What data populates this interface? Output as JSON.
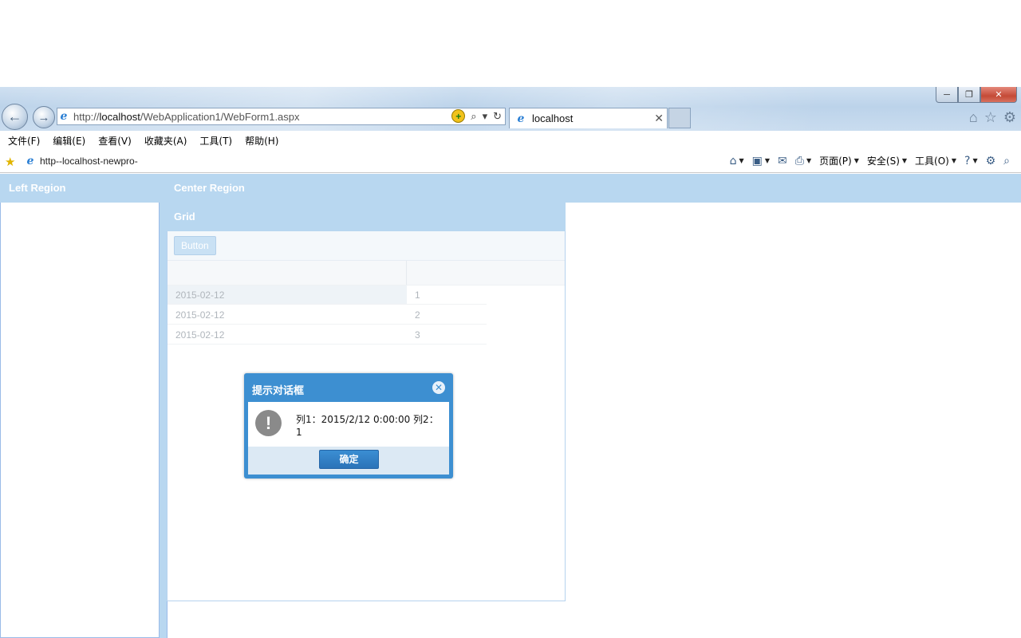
{
  "browser": {
    "ghost_title": "",
    "window_buttons": {
      "minimize": "─",
      "restore": "❐",
      "close": "✕"
    },
    "nav": {
      "back_icon": "←",
      "forward_icon": "→"
    },
    "address": {
      "prefix": "http://",
      "host": "localhost",
      "path": "/WebApplication1/WebForm1.aspx",
      "compat_icon": "+",
      "search_icon": "⌕",
      "dropdown_icon": "▾",
      "refresh_icon": "↻"
    },
    "tab": {
      "title": "localhost",
      "close": "✕"
    },
    "right_icons": {
      "home": "⌂",
      "favorites": "☆",
      "tools": "⚙"
    },
    "menu": [
      "文件(F)",
      "编辑(E)",
      "查看(V)",
      "收藏夹(A)",
      "工具(T)",
      "帮助(H)"
    ],
    "favbar": {
      "link": "http--localhost-newpro-",
      "commands": {
        "page": "页面(P)",
        "safety": "安全(S)",
        "tools": "工具(O)"
      }
    }
  },
  "page": {
    "left_region_title": "Left Region",
    "center_region_title": "Center Region",
    "grid": {
      "title": "Grid",
      "button_label": "Button",
      "rows": [
        {
          "date": "2015-02-12",
          "num": "1"
        },
        {
          "date": "2015-02-12",
          "num": "2"
        },
        {
          "date": "2015-02-12",
          "num": "3"
        }
      ]
    }
  },
  "dialog": {
    "title": "提示对话框",
    "close_icon": "✕",
    "alert_icon": "!",
    "message": "列1：2015/2/12 0:00:00 列2：1",
    "ok_label": "确定"
  }
}
